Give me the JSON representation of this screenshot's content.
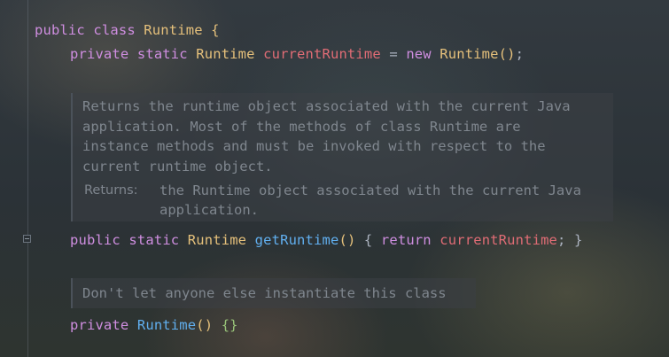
{
  "code": {
    "line1": {
      "kw1": "public",
      "kw2": "class",
      "name": "Runtime",
      "brace": "{"
    },
    "line2": {
      "kw1": "private",
      "kw2": "static",
      "type": "Runtime",
      "field": "currentRuntime",
      "eq": "=",
      "kwnew": "new",
      "ctor": "Runtime",
      "parens": "()",
      "semi": ";"
    },
    "doc1": {
      "lines": [
        "Returns the runtime object associated with the current Java",
        "application. Most of the methods of class Runtime are",
        "instance methods and must be invoked with respect to the",
        "current runtime object."
      ],
      "returns_label": "Returns:",
      "returns_lines": [
        "the Runtime object associated with the current Java",
        "application."
      ]
    },
    "line3": {
      "kw1": "public",
      "kw2": "static",
      "type": "Runtime",
      "method": "getRuntime",
      "parens": "()",
      "open": "{",
      "kwret": "return",
      "field": "currentRuntime",
      "semi": ";",
      "close": "}"
    },
    "doc2": {
      "text": "Don't let anyone else instantiate this class"
    },
    "line4": {
      "kw1": "private",
      "ctor": "Runtime",
      "parens": "()",
      "braces": "{}"
    }
  }
}
